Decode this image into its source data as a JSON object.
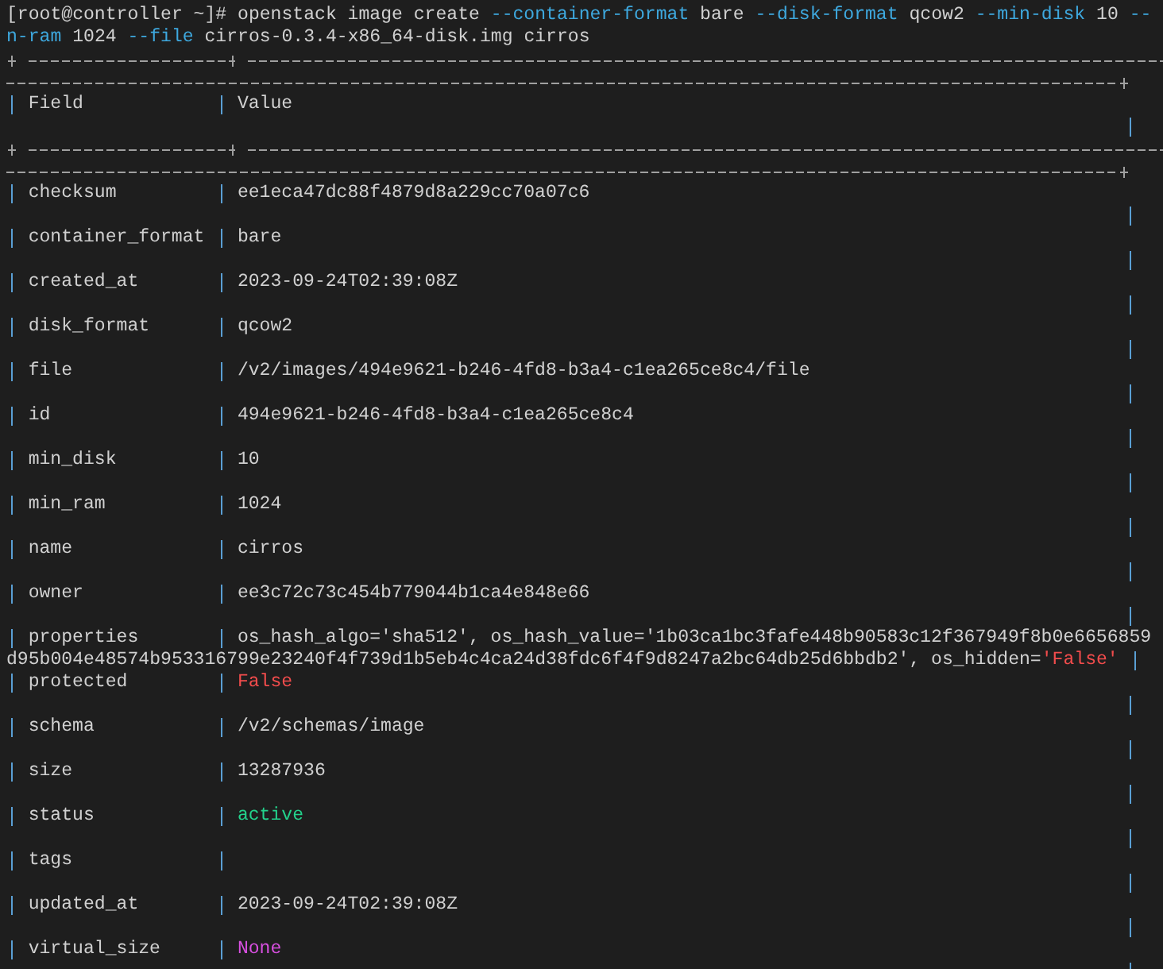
{
  "command": [
    [
      {
        "text": "[root@controller ~]# openstack image create ",
        "kind": "plain"
      },
      {
        "text": "--container-format",
        "kind": "flag"
      },
      {
        "text": " bare ",
        "kind": "plain"
      },
      {
        "text": "--disk-format",
        "kind": "flag"
      },
      {
        "text": " qcow2 ",
        "kind": "plain"
      },
      {
        "text": "--min-disk",
        "kind": "flag"
      },
      {
        "text": " 10 ",
        "kind": "plain"
      },
      {
        "text": "--",
        "kind": "flag"
      }
    ],
    [
      {
        "text": "n-ram",
        "kind": "flag"
      },
      {
        "text": " 1024 ",
        "kind": "plain"
      },
      {
        "text": "--file",
        "kind": "flag"
      },
      {
        "text": " cirros-0.3.4-x86_64-disk.img cirros",
        "kind": "plain"
      }
    ]
  ],
  "table": {
    "columns": [
      "Field",
      "Value"
    ],
    "rows": [
      {
        "field": "checksum",
        "value": [
          [
            {
              "text": "ee1eca47dc88f4879d8a229cc70a07c6",
              "kind": "plain"
            }
          ]
        ]
      },
      {
        "field": "container_format",
        "value": [
          [
            {
              "text": "bare",
              "kind": "plain"
            }
          ]
        ]
      },
      {
        "field": "created_at",
        "value": [
          [
            {
              "text": "2023-09-24T02:39:08Z",
              "kind": "plain"
            }
          ]
        ]
      },
      {
        "field": "disk_format",
        "value": [
          [
            {
              "text": "qcow2",
              "kind": "plain"
            }
          ]
        ]
      },
      {
        "field": "file",
        "value": [
          [
            {
              "text": "/v2/images/494e9621-b246-4fd8-b3a4-c1ea265ce8c4/file",
              "kind": "plain"
            }
          ]
        ]
      },
      {
        "field": "id",
        "value": [
          [
            {
              "text": "494e9621-b246-4fd8-b3a4-c1ea265ce8c4",
              "kind": "plain"
            }
          ]
        ]
      },
      {
        "field": "min_disk",
        "value": [
          [
            {
              "text": "10",
              "kind": "plain"
            }
          ]
        ]
      },
      {
        "field": "min_ram",
        "value": [
          [
            {
              "text": "1024",
              "kind": "plain"
            }
          ]
        ]
      },
      {
        "field": "name",
        "value": [
          [
            {
              "text": "cirros",
              "kind": "plain"
            }
          ]
        ]
      },
      {
        "field": "owner",
        "value": [
          [
            {
              "text": "ee3c72c73c454b779044b1ca4e848e66",
              "kind": "plain"
            }
          ]
        ]
      },
      {
        "field": "properties",
        "value": [
          [
            {
              "text": "os_hash_algo='sha512', os_hash_value='1b03ca1bc3fafe448b90583c12f367949f8b0e6656859",
              "kind": "plain"
            }
          ],
          [
            {
              "text": "d95b004e48574b953316799e23240f4f739d1b5eb4c4ca24d38fdc6f4f9d8247a2bc64db25d6bbdb2', os_hidden=",
              "kind": "plain"
            },
            {
              "text": "'False'",
              "kind": "error"
            }
          ]
        ]
      },
      {
        "field": "protected",
        "value": [
          [
            {
              "text": "False",
              "kind": "error"
            }
          ]
        ]
      },
      {
        "field": "schema",
        "value": [
          [
            {
              "text": "/v2/schemas/image",
              "kind": "plain"
            }
          ]
        ]
      },
      {
        "field": "size",
        "value": [
          [
            {
              "text": "13287936",
              "kind": "plain"
            }
          ]
        ]
      },
      {
        "field": "status",
        "value": [
          [
            {
              "text": "active",
              "kind": "success"
            }
          ]
        ]
      },
      {
        "field": "tags"
      },
      {
        "field": "updated_at",
        "value": [
          [
            {
              "text": "2023-09-24T02:39:08Z",
              "kind": "plain"
            }
          ]
        ]
      },
      {
        "field": "virtual_size",
        "value": [
          [
            {
              "text": "None",
              "kind": "null"
            }
          ]
        ]
      }
    ]
  }
}
